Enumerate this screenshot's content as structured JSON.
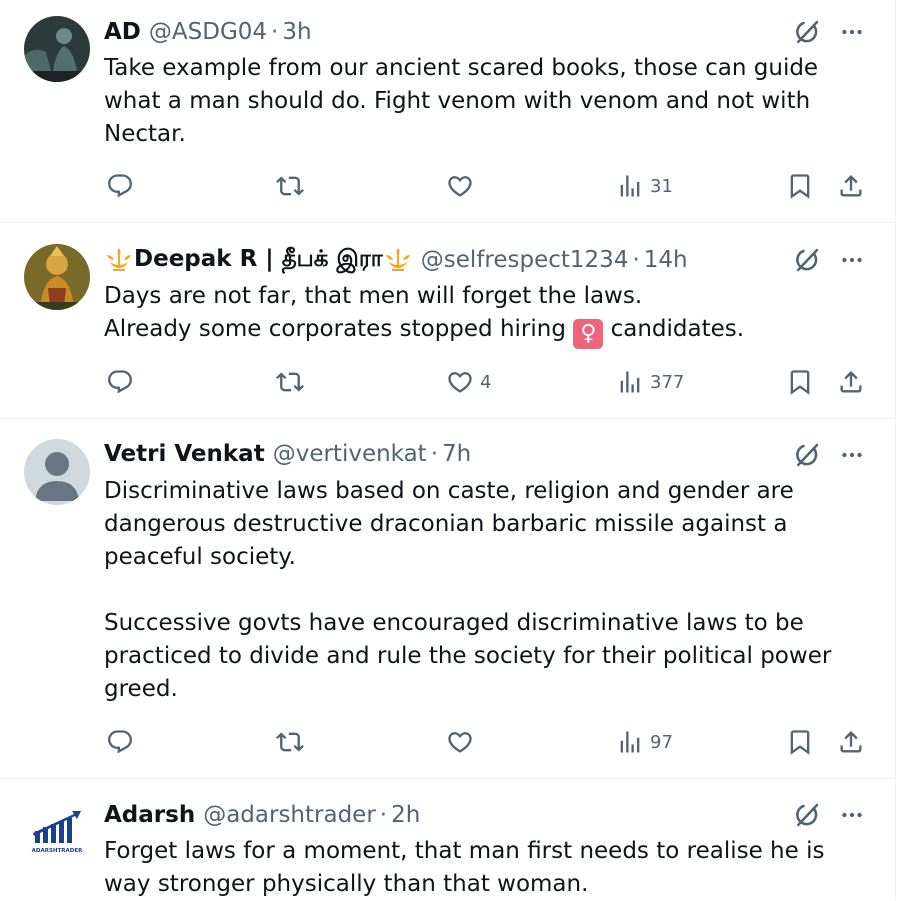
{
  "tweets": [
    {
      "name": "AD",
      "handle": "@ASDG04",
      "time": "3h",
      "lines": [
        "Take example from our ancient scared books, those can guide",
        "what a man should do. Fight venom with venom and not with",
        "Nectar."
      ],
      "replies": "",
      "reposts": "",
      "likes": "",
      "views": "31"
    },
    {
      "name": "Deepak R | தீபக் இரா",
      "handle": "@selfrespect1234",
      "time": "14h",
      "line1": "Days are not far, that men will forget the laws.",
      "line2_before": "Already some corporates stopped hiring ",
      "emoji": "♀",
      "line2_after": " candidates.",
      "replies": "",
      "reposts": "",
      "likes": "4",
      "views": "377"
    },
    {
      "name": "Vetri Venkat",
      "handle": "@vertivenkat",
      "time": "7h",
      "lines": [
        "Discriminative laws based on caste, religion and gender are",
        "dangerous destructive draconian barbaric missile against a",
        "peaceful society.",
        "",
        "Successive govts have encouraged discriminative laws to be",
        "practiced to divide and rule the society for their political power",
        "greed."
      ],
      "replies": "",
      "reposts": "",
      "likes": "",
      "views": "97"
    },
    {
      "name": "Adarsh",
      "handle": "@adarshtrader",
      "time": "2h",
      "logo_text": "ADARSHTRADER",
      "lines": [
        "Forget laws for a moment, that man first needs to realise he is",
        "way stronger physically than that woman."
      ]
    }
  ],
  "separator": "·",
  "colors": {
    "text": "#0f1419",
    "muted": "#536471",
    "divider": "#eff3f4",
    "emoji_bg": "#f0637c",
    "emblem": "#f5a623",
    "logo_blue": "#1c3f8c"
  },
  "icons": [
    "reply-icon",
    "repost-icon",
    "like-icon",
    "views-icon",
    "bookmark-icon",
    "share-icon",
    "grok-icon",
    "more-icon"
  ]
}
